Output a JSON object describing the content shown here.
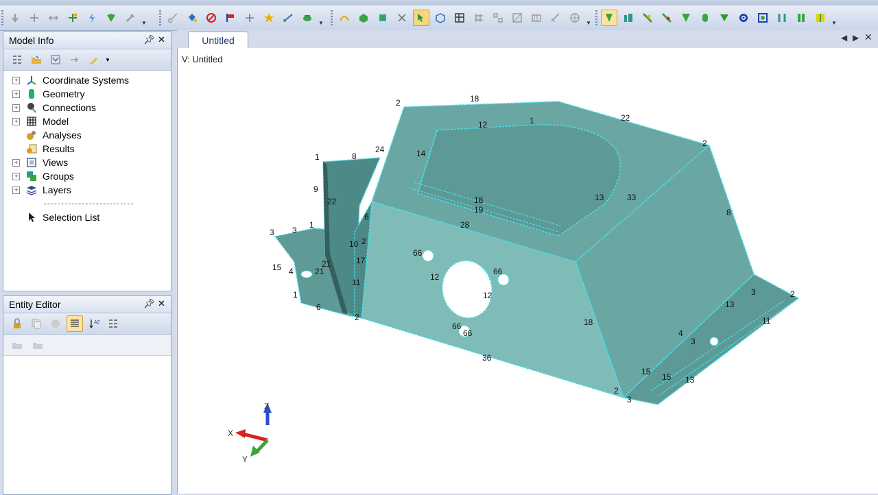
{
  "toolbar": {
    "groups": [
      "edit-tools",
      "geometry-tools",
      "meshing-tools",
      "view-tools"
    ]
  },
  "model_info": {
    "title": "Model Info",
    "pin": "✖",
    "close": "✕",
    "tree": [
      {
        "label": "Coordinate Systems",
        "icon": "axes-icon",
        "expandable": true
      },
      {
        "label": "Geometry",
        "icon": "geometry-icon",
        "expandable": true
      },
      {
        "label": "Connections",
        "icon": "connections-icon",
        "expandable": true
      },
      {
        "label": "Model",
        "icon": "model-icon",
        "expandable": true
      },
      {
        "label": "Analyses",
        "icon": "analyses-icon",
        "expandable": false
      },
      {
        "label": "Results",
        "icon": "results-icon",
        "expandable": false
      },
      {
        "label": "Views",
        "icon": "views-icon",
        "expandable": true
      },
      {
        "label": "Groups",
        "icon": "groups-icon",
        "expandable": true
      },
      {
        "label": "Layers",
        "icon": "layers-icon",
        "expandable": true
      },
      {
        "label": "Selection List",
        "icon": "selection-cursor-icon",
        "expandable": false
      }
    ]
  },
  "entity_editor": {
    "title": "Entity Editor"
  },
  "document": {
    "tab_label": "Untitled",
    "view_label": "V: Untitled"
  },
  "triad": {
    "x": "X",
    "y": "Y",
    "z": "Z"
  },
  "colors": {
    "model_face": "#6aa7a3",
    "model_face_light": "#82c1bd",
    "model_edge": "#46e0ec",
    "panel_bg": "#d4dceb"
  },
  "edge_labels": [
    "2",
    "18",
    "12",
    "1",
    "22",
    "2",
    "24",
    "14",
    "8",
    "1",
    "9",
    "22",
    "6",
    "3",
    "13",
    "33",
    "18",
    "19",
    "28",
    "3",
    "1",
    "21",
    "2",
    "10",
    "66",
    "17",
    "66",
    "12",
    "66",
    "15",
    "4",
    "21",
    "8",
    "11",
    "12",
    "1",
    "6",
    "2",
    "66",
    "18",
    "36",
    "2",
    "3",
    "13",
    "11",
    "4",
    "3",
    "15",
    "15",
    "13",
    "3",
    "2"
  ]
}
